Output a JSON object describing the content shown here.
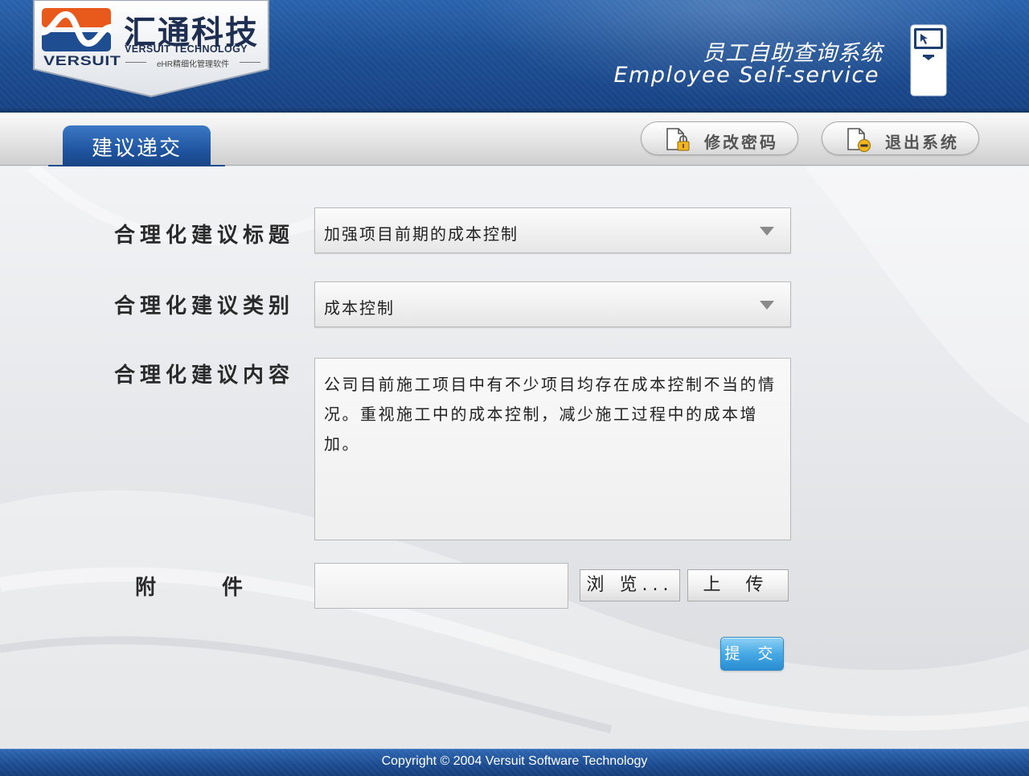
{
  "header": {
    "logo": {
      "company_cn": "汇通科技",
      "company_en": "VERSUIT TECHNOLOGY",
      "product_line": "eHR精细化管理软件",
      "wordmark": "VERSUIT"
    },
    "system_title_cn": "员工自助查询系统",
    "system_title_en": "Employee Self-service",
    "kiosk_icon": "kiosk-terminal-icon"
  },
  "toolbar": {
    "active_tab": "建议递交",
    "buttons": [
      {
        "label": "修改密码",
        "icon": "lock-document-icon"
      },
      {
        "label": "退出系统",
        "icon": "exit-document-icon"
      }
    ]
  },
  "form": {
    "title_label": "合理化建议标题",
    "title_value": "加强项目前期的成本控制",
    "type_label": "合理化建议类别",
    "type_value": "成本控制",
    "content_label": "合理化建议内容",
    "content_value": "公司目前施工项目中有不少项目均存在成本控制不当的情况。重视施工中的成本控制，减少施工过程中的成本增加。",
    "attachment_label_1": "附",
    "attachment_label_2": "件",
    "attachment_value": "",
    "browse_label": "浏 览...",
    "upload_label": "上 传",
    "submit_label": "提 交"
  },
  "footer": {
    "copyright": "Copyright © 2004 Versuit Software Technology"
  },
  "colors": {
    "header_blue": "#1d4f94",
    "tab_blue": "#1f549f",
    "submit_blue": "#47a9e4",
    "logo_orange": "#e8591c"
  }
}
